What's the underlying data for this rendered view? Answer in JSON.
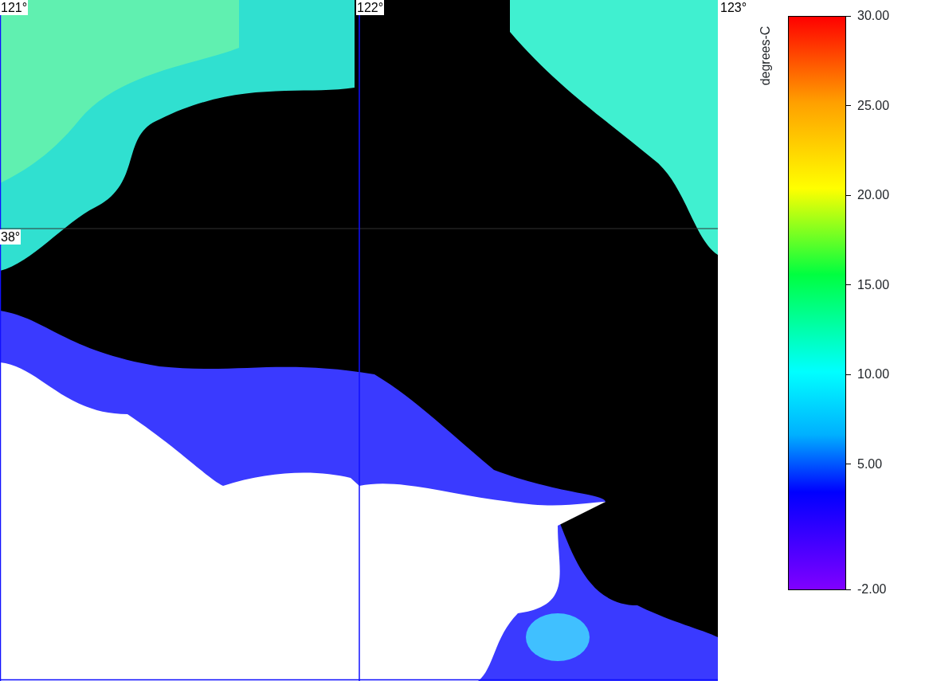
{
  "map": {
    "lon_labels": [
      "121°",
      "122°",
      "123°"
    ],
    "lat_labels": [
      "38°"
    ]
  },
  "colorbar": {
    "title": "degrees-C",
    "ticks": [
      "30.00",
      "25.00",
      "20.00",
      "15.00",
      "10.00",
      "5.00",
      "-2.00"
    ]
  }
}
